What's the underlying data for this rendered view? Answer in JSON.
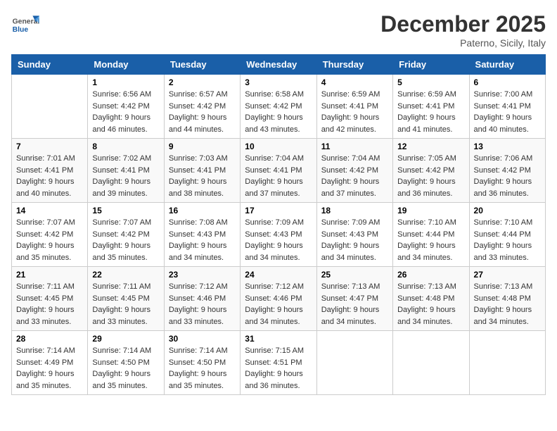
{
  "header": {
    "logo_general": "General",
    "logo_blue": "Blue",
    "month_title": "December 2025",
    "subtitle": "Paterno, Sicily, Italy"
  },
  "weekdays": [
    "Sunday",
    "Monday",
    "Tuesday",
    "Wednesday",
    "Thursday",
    "Friday",
    "Saturday"
  ],
  "weeks": [
    [
      {
        "day": "",
        "info": ""
      },
      {
        "day": "1",
        "info": "Sunrise: 6:56 AM\nSunset: 4:42 PM\nDaylight: 9 hours\nand 46 minutes."
      },
      {
        "day": "2",
        "info": "Sunrise: 6:57 AM\nSunset: 4:42 PM\nDaylight: 9 hours\nand 44 minutes."
      },
      {
        "day": "3",
        "info": "Sunrise: 6:58 AM\nSunset: 4:42 PM\nDaylight: 9 hours\nand 43 minutes."
      },
      {
        "day": "4",
        "info": "Sunrise: 6:59 AM\nSunset: 4:41 PM\nDaylight: 9 hours\nand 42 minutes."
      },
      {
        "day": "5",
        "info": "Sunrise: 6:59 AM\nSunset: 4:41 PM\nDaylight: 9 hours\nand 41 minutes."
      },
      {
        "day": "6",
        "info": "Sunrise: 7:00 AM\nSunset: 4:41 PM\nDaylight: 9 hours\nand 40 minutes."
      }
    ],
    [
      {
        "day": "7",
        "info": "Sunrise: 7:01 AM\nSunset: 4:41 PM\nDaylight: 9 hours\nand 40 minutes."
      },
      {
        "day": "8",
        "info": "Sunrise: 7:02 AM\nSunset: 4:41 PM\nDaylight: 9 hours\nand 39 minutes."
      },
      {
        "day": "9",
        "info": "Sunrise: 7:03 AM\nSunset: 4:41 PM\nDaylight: 9 hours\nand 38 minutes."
      },
      {
        "day": "10",
        "info": "Sunrise: 7:04 AM\nSunset: 4:41 PM\nDaylight: 9 hours\nand 37 minutes."
      },
      {
        "day": "11",
        "info": "Sunrise: 7:04 AM\nSunset: 4:42 PM\nDaylight: 9 hours\nand 37 minutes."
      },
      {
        "day": "12",
        "info": "Sunrise: 7:05 AM\nSunset: 4:42 PM\nDaylight: 9 hours\nand 36 minutes."
      },
      {
        "day": "13",
        "info": "Sunrise: 7:06 AM\nSunset: 4:42 PM\nDaylight: 9 hours\nand 36 minutes."
      }
    ],
    [
      {
        "day": "14",
        "info": "Sunrise: 7:07 AM\nSunset: 4:42 PM\nDaylight: 9 hours\nand 35 minutes."
      },
      {
        "day": "15",
        "info": "Sunrise: 7:07 AM\nSunset: 4:42 PM\nDaylight: 9 hours\nand 35 minutes."
      },
      {
        "day": "16",
        "info": "Sunrise: 7:08 AM\nSunset: 4:43 PM\nDaylight: 9 hours\nand 34 minutes."
      },
      {
        "day": "17",
        "info": "Sunrise: 7:09 AM\nSunset: 4:43 PM\nDaylight: 9 hours\nand 34 minutes."
      },
      {
        "day": "18",
        "info": "Sunrise: 7:09 AM\nSunset: 4:43 PM\nDaylight: 9 hours\nand 34 minutes."
      },
      {
        "day": "19",
        "info": "Sunrise: 7:10 AM\nSunset: 4:44 PM\nDaylight: 9 hours\nand 34 minutes."
      },
      {
        "day": "20",
        "info": "Sunrise: 7:10 AM\nSunset: 4:44 PM\nDaylight: 9 hours\nand 33 minutes."
      }
    ],
    [
      {
        "day": "21",
        "info": "Sunrise: 7:11 AM\nSunset: 4:45 PM\nDaylight: 9 hours\nand 33 minutes."
      },
      {
        "day": "22",
        "info": "Sunrise: 7:11 AM\nSunset: 4:45 PM\nDaylight: 9 hours\nand 33 minutes."
      },
      {
        "day": "23",
        "info": "Sunrise: 7:12 AM\nSunset: 4:46 PM\nDaylight: 9 hours\nand 33 minutes."
      },
      {
        "day": "24",
        "info": "Sunrise: 7:12 AM\nSunset: 4:46 PM\nDaylight: 9 hours\nand 34 minutes."
      },
      {
        "day": "25",
        "info": "Sunrise: 7:13 AM\nSunset: 4:47 PM\nDaylight: 9 hours\nand 34 minutes."
      },
      {
        "day": "26",
        "info": "Sunrise: 7:13 AM\nSunset: 4:48 PM\nDaylight: 9 hours\nand 34 minutes."
      },
      {
        "day": "27",
        "info": "Sunrise: 7:13 AM\nSunset: 4:48 PM\nDaylight: 9 hours\nand 34 minutes."
      }
    ],
    [
      {
        "day": "28",
        "info": "Sunrise: 7:14 AM\nSunset: 4:49 PM\nDaylight: 9 hours\nand 35 minutes."
      },
      {
        "day": "29",
        "info": "Sunrise: 7:14 AM\nSunset: 4:50 PM\nDaylight: 9 hours\nand 35 minutes."
      },
      {
        "day": "30",
        "info": "Sunrise: 7:14 AM\nSunset: 4:50 PM\nDaylight: 9 hours\nand 35 minutes."
      },
      {
        "day": "31",
        "info": "Sunrise: 7:15 AM\nSunset: 4:51 PM\nDaylight: 9 hours\nand 36 minutes."
      },
      {
        "day": "",
        "info": ""
      },
      {
        "day": "",
        "info": ""
      },
      {
        "day": "",
        "info": ""
      }
    ]
  ]
}
